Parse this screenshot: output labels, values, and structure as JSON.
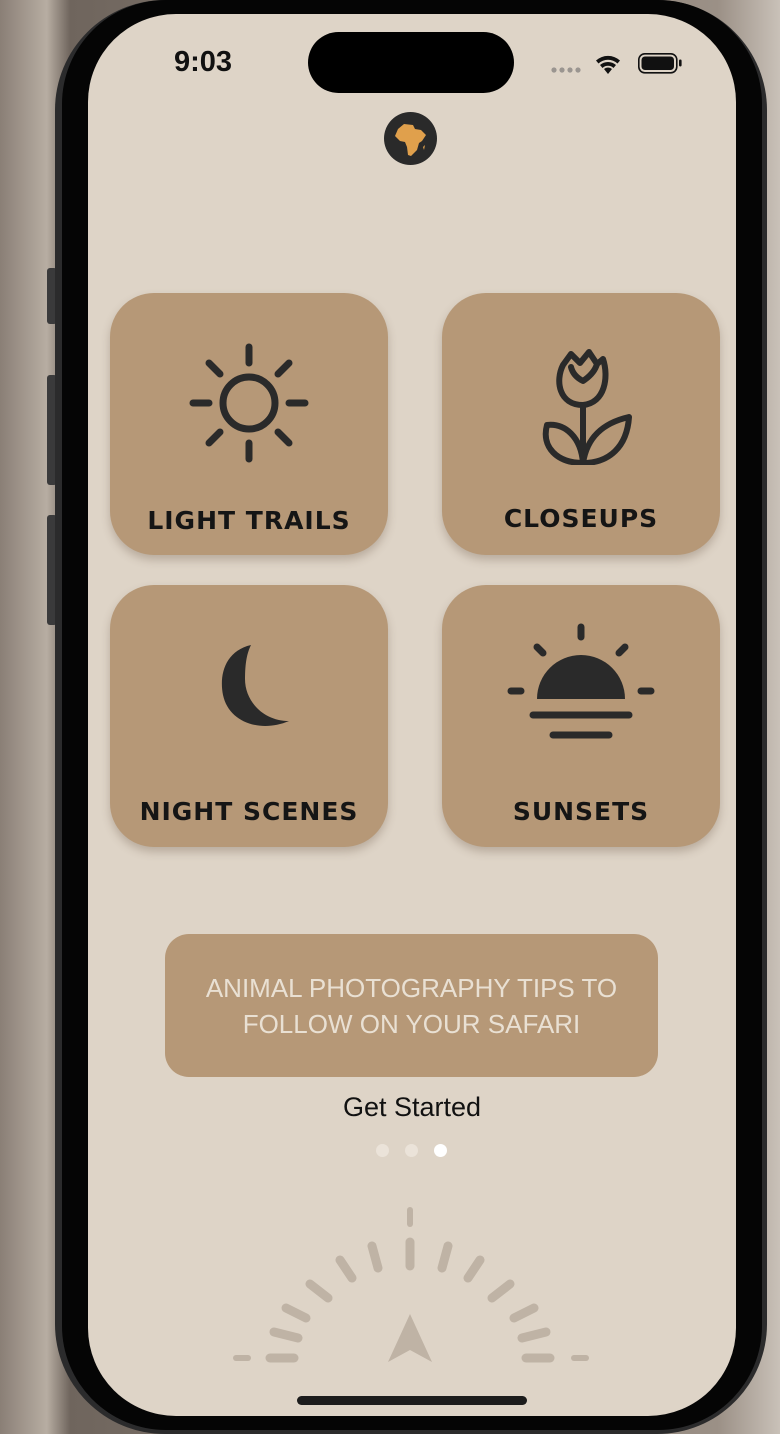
{
  "status_bar": {
    "time": "9:03",
    "icons": [
      "signal-dots-icon",
      "wifi-icon",
      "battery-icon"
    ]
  },
  "header": {
    "logo_icon": "africa-map-icon"
  },
  "categories": [
    {
      "label": "LIGHT TRAILS",
      "icon": "sun-icon"
    },
    {
      "label": "CLOSEUPS",
      "icon": "tulip-flower-icon"
    },
    {
      "label": "NIGHT SCENES",
      "icon": "crescent-moon-icon"
    },
    {
      "label": "SUNSETS",
      "icon": "sunset-icon"
    }
  ],
  "tips_banner": {
    "line1": "ANIMAL PHOTOGRAPHY TIPS TO",
    "line2": "FOLLOW ON YOUR SAFARI"
  },
  "cta": {
    "label": "Get Started"
  },
  "pager": {
    "total": 3,
    "active_index": 2
  },
  "footer": {
    "icon": "compass-gauge-icon"
  },
  "colors": {
    "background": "#ded4c7",
    "card": "#b69877",
    "icon_dark": "#2a2a2a",
    "logo_accent": "#e0a04c",
    "tips_text": "#e9e0d3"
  }
}
